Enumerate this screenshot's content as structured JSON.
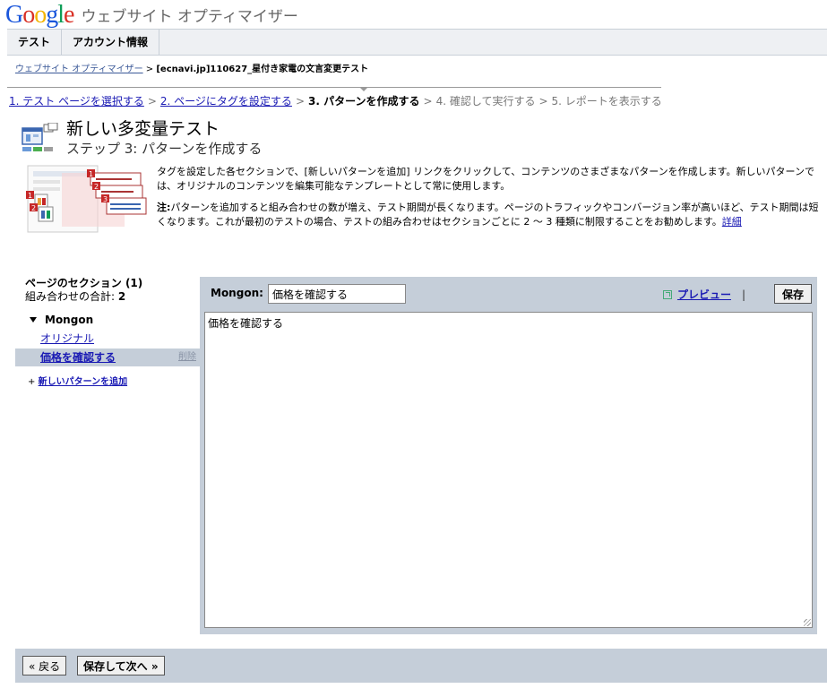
{
  "header": {
    "logo_text": "Google",
    "product_name": "ウェブサイト オプティマイザー",
    "logo_colors": [
      "#1a56db",
      "#d93025",
      "#f4b400",
      "#1a56db",
      "#0f9d58",
      "#d93025"
    ]
  },
  "tabs": [
    {
      "label": "テスト"
    },
    {
      "label": "アカウント情報"
    }
  ],
  "breadcrumb": {
    "root": "ウェブサイト オプティマイザー",
    "sep": ">",
    "current": "[ecnavi.jp]110627_星付き家電の文言変更テスト"
  },
  "steps": {
    "s1": "1. テスト ページを選択する",
    "s2": "2. ページにタグを設定する",
    "s3": "3. パターンを作成する",
    "s4": "4. 確認して実行する",
    "s5": "5. レポートを表示する",
    "sep": ">"
  },
  "page": {
    "title": "新しい多変量テスト",
    "subtitle": "ステップ 3: パターンを作成する"
  },
  "description": {
    "para1": "タグを設定した各セクションで、[新しいパターンを追加] リンクをクリックして、コンテンツのさまざまなパターンを作成します。新しいパターンでは、オリジナルのコンテンツを編集可能なテンプレートとして常に使用します。",
    "note_label": "注:",
    "note_text": "パターンを追加すると組み合わせの数が増え、テスト期間が長くなります。ページのトラフィックやコンバージョン率が高いほど、テスト期間は短くなります。これが最初のテストの場合、テストの組み合わせはセクションごとに 2 ～ 3 種類に制限することをお勧めします。",
    "details_link": "詳細"
  },
  "sections": {
    "heading": "ページのセクション (1)",
    "combos_label": "組み合わせの合計: ",
    "combos_value": "2",
    "group_name": "Mongon",
    "original_label": "オリジナル",
    "selected_label": "価格を確認する",
    "delete_label": "削除",
    "add_plus": "+",
    "add_label": "新しいパターンを追加"
  },
  "editor": {
    "label": "Mongon:",
    "name_value": "価格を確認する",
    "preview_label": "プレビュー",
    "pipe": "|",
    "save_label": "保存",
    "content": "価格を確認する"
  },
  "footer": {
    "back_label": "« 戻る",
    "next_label": "保存して次へ »"
  }
}
